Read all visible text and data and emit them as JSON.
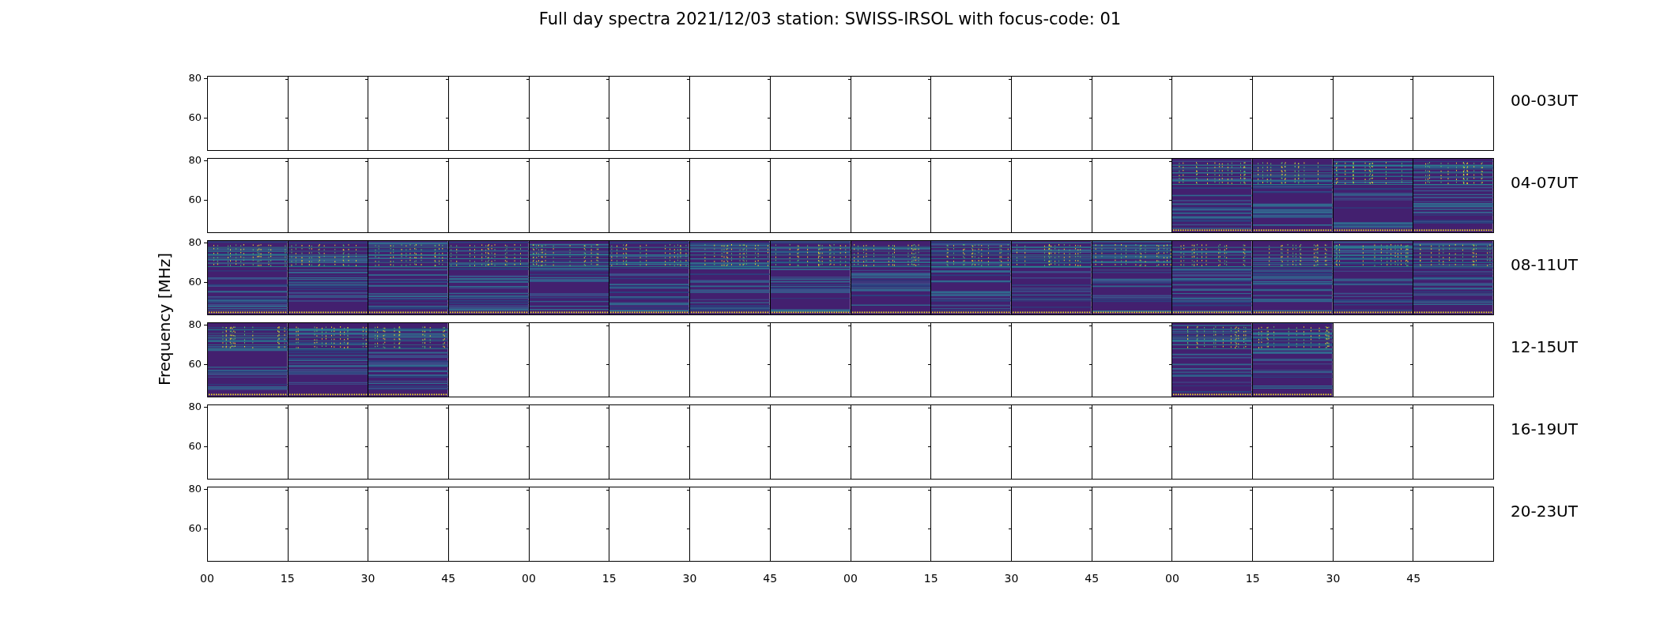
{
  "title": "Full day spectra 2021/12/03 station: SWISS-IRSOL with focus-code: 01",
  "ylabel": "Frequency [MHz]",
  "xticks": [
    "00",
    "15",
    "30",
    "45",
    "00",
    "15",
    "30",
    "45",
    "00",
    "15",
    "30",
    "45",
    "00",
    "15",
    "30",
    "45"
  ],
  "rows": [
    {
      "label": "00-03UT",
      "yticks": [
        "80",
        "60"
      ],
      "panels": [
        {
          "kind": "empty"
        },
        {
          "kind": "empty"
        },
        {
          "kind": "empty"
        },
        {
          "kind": "empty"
        },
        {
          "kind": "empty"
        },
        {
          "kind": "empty"
        },
        {
          "kind": "empty"
        },
        {
          "kind": "empty"
        },
        {
          "kind": "empty"
        },
        {
          "kind": "empty"
        },
        {
          "kind": "empty"
        },
        {
          "kind": "empty"
        },
        {
          "kind": "empty"
        },
        {
          "kind": "empty"
        },
        {
          "kind": "empty"
        },
        {
          "kind": "empty"
        }
      ]
    },
    {
      "label": "04-07UT",
      "yticks": [
        "80",
        "60"
      ],
      "panels": [
        {
          "kind": "empty"
        },
        {
          "kind": "empty"
        },
        {
          "kind": "empty"
        },
        {
          "kind": "empty"
        },
        {
          "kind": "empty"
        },
        {
          "kind": "empty"
        },
        {
          "kind": "empty"
        },
        {
          "kind": "empty"
        },
        {
          "kind": "empty"
        },
        {
          "kind": "empty"
        },
        {
          "kind": "empty"
        },
        {
          "kind": "empty"
        },
        {
          "kind": "spectrum"
        },
        {
          "kind": "spectrum"
        },
        {
          "kind": "spectrum"
        },
        {
          "kind": "spectrum"
        }
      ]
    },
    {
      "label": "08-11UT",
      "yticks": [
        "80",
        "60"
      ],
      "panels": [
        {
          "kind": "spectrum"
        },
        {
          "kind": "spectrum"
        },
        {
          "kind": "spectrum"
        },
        {
          "kind": "spectrum"
        },
        {
          "kind": "spectrum"
        },
        {
          "kind": "spectrum"
        },
        {
          "kind": "spectrum"
        },
        {
          "kind": "spectrum"
        },
        {
          "kind": "spectrum"
        },
        {
          "kind": "spectrum"
        },
        {
          "kind": "spectrum"
        },
        {
          "kind": "spectrum"
        },
        {
          "kind": "spectrum"
        },
        {
          "kind": "spectrum"
        },
        {
          "kind": "spectrum"
        },
        {
          "kind": "spectrum"
        }
      ]
    },
    {
      "label": "12-15UT",
      "yticks": [
        "80",
        "60"
      ],
      "panels": [
        {
          "kind": "spectrum"
        },
        {
          "kind": "spectrum"
        },
        {
          "kind": "spectrum"
        },
        {
          "kind": "empty"
        },
        {
          "kind": "empty"
        },
        {
          "kind": "empty"
        },
        {
          "kind": "empty"
        },
        {
          "kind": "empty"
        },
        {
          "kind": "empty"
        },
        {
          "kind": "empty"
        },
        {
          "kind": "empty"
        },
        {
          "kind": "empty"
        },
        {
          "kind": "spectrum"
        },
        {
          "kind": "spectrum"
        },
        {
          "kind": "empty"
        },
        {
          "kind": "empty"
        }
      ]
    },
    {
      "label": "16-19UT",
      "yticks": [
        "80",
        "60"
      ],
      "panels": [
        {
          "kind": "empty"
        },
        {
          "kind": "empty"
        },
        {
          "kind": "empty"
        },
        {
          "kind": "empty"
        },
        {
          "kind": "empty"
        },
        {
          "kind": "empty"
        },
        {
          "kind": "empty"
        },
        {
          "kind": "empty"
        },
        {
          "kind": "empty"
        },
        {
          "kind": "empty"
        },
        {
          "kind": "empty"
        },
        {
          "kind": "empty"
        },
        {
          "kind": "empty"
        },
        {
          "kind": "empty"
        },
        {
          "kind": "empty"
        },
        {
          "kind": "empty"
        }
      ]
    },
    {
      "label": "20-23UT",
      "yticks": [
        "80",
        "60"
      ],
      "panels": [
        {
          "kind": "empty"
        },
        {
          "kind": "empty"
        },
        {
          "kind": "empty"
        },
        {
          "kind": "empty"
        },
        {
          "kind": "empty"
        },
        {
          "kind": "empty"
        },
        {
          "kind": "empty"
        },
        {
          "kind": "empty"
        },
        {
          "kind": "empty"
        },
        {
          "kind": "empty"
        },
        {
          "kind": "empty"
        },
        {
          "kind": "empty"
        },
        {
          "kind": "empty"
        },
        {
          "kind": "empty"
        },
        {
          "kind": "empty"
        },
        {
          "kind": "empty"
        }
      ]
    }
  ]
}
